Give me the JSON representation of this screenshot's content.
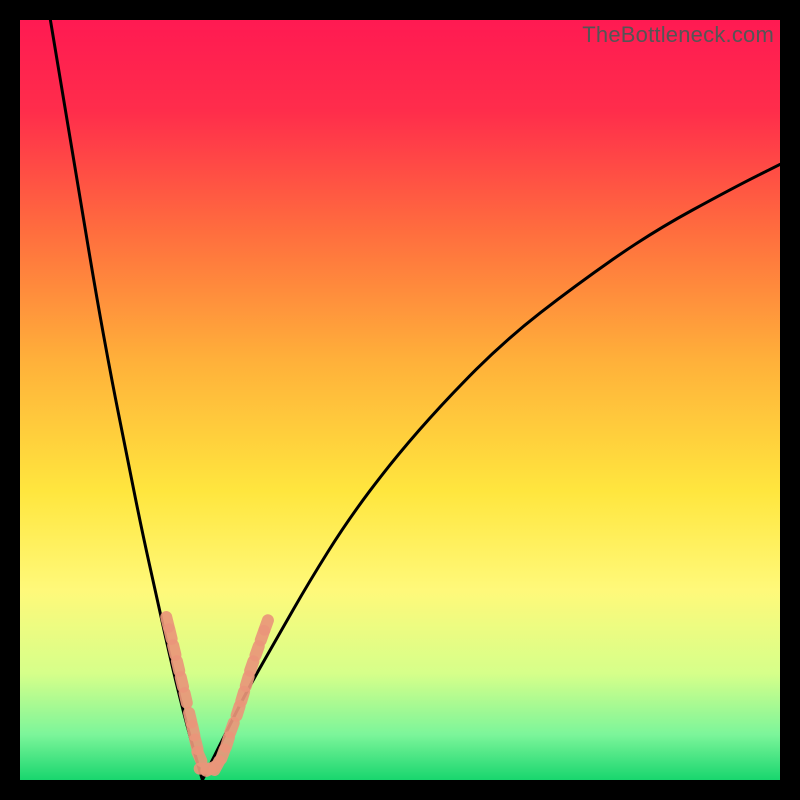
{
  "watermark": "TheBottleneck.com",
  "colors": {
    "gradient_stops": [
      {
        "offset": 0.0,
        "color": "#ff1a52"
      },
      {
        "offset": 0.12,
        "color": "#ff2d4b"
      },
      {
        "offset": 0.28,
        "color": "#ff6e3e"
      },
      {
        "offset": 0.45,
        "color": "#ffb13a"
      },
      {
        "offset": 0.62,
        "color": "#ffe63e"
      },
      {
        "offset": 0.75,
        "color": "#fff97a"
      },
      {
        "offset": 0.86,
        "color": "#d6ff8a"
      },
      {
        "offset": 0.94,
        "color": "#7cf59a"
      },
      {
        "offset": 1.0,
        "color": "#18d66e"
      }
    ],
    "curve": "#000000",
    "markers": "#e9967a",
    "frame": "#000000"
  },
  "chart_data": {
    "type": "line",
    "title": "",
    "xlabel": "",
    "ylabel": "",
    "xlim": [
      0,
      100
    ],
    "ylim": [
      0,
      100
    ],
    "nadir_x": 24,
    "series": [
      {
        "name": "left-branch",
        "x": [
          4,
          6,
          8,
          10,
          12,
          14,
          16,
          18,
          20,
          22,
          24
        ],
        "y": [
          100,
          88,
          76,
          64,
          53,
          43,
          33,
          24,
          15,
          7,
          0
        ]
      },
      {
        "name": "right-branch",
        "x": [
          24,
          27,
          30,
          34,
          38,
          43,
          49,
          56,
          64,
          73,
          83,
          94,
          100
        ],
        "y": [
          0,
          6,
          12,
          19,
          26,
          34,
          42,
          50,
          58,
          65,
          72,
          78,
          81
        ]
      }
    ],
    "markers": {
      "name": "highlighted-points",
      "points": [
        {
          "x": 19.4,
          "y": 20.8
        },
        {
          "x": 19.8,
          "y": 19.2
        },
        {
          "x": 20.3,
          "y": 17.1
        },
        {
          "x": 20.8,
          "y": 15.0
        },
        {
          "x": 21.3,
          "y": 12.9
        },
        {
          "x": 21.8,
          "y": 10.8
        },
        {
          "x": 22.4,
          "y": 8.2
        },
        {
          "x": 22.8,
          "y": 6.5
        },
        {
          "x": 23.2,
          "y": 4.7
        },
        {
          "x": 23.6,
          "y": 3.1
        },
        {
          "x": 24.3,
          "y": 1.5
        },
        {
          "x": 25.1,
          "y": 1.5
        },
        {
          "x": 25.9,
          "y": 1.9
        },
        {
          "x": 26.7,
          "y": 3.4
        },
        {
          "x": 27.3,
          "y": 5.0
        },
        {
          "x": 27.9,
          "y": 6.9
        },
        {
          "x": 28.7,
          "y": 9.1
        },
        {
          "x": 29.3,
          "y": 11.0
        },
        {
          "x": 29.9,
          "y": 13.0
        },
        {
          "x": 30.5,
          "y": 15.0
        },
        {
          "x": 31.2,
          "y": 17.0
        },
        {
          "x": 31.9,
          "y": 19.0
        },
        {
          "x": 32.4,
          "y": 20.4
        }
      ]
    }
  }
}
